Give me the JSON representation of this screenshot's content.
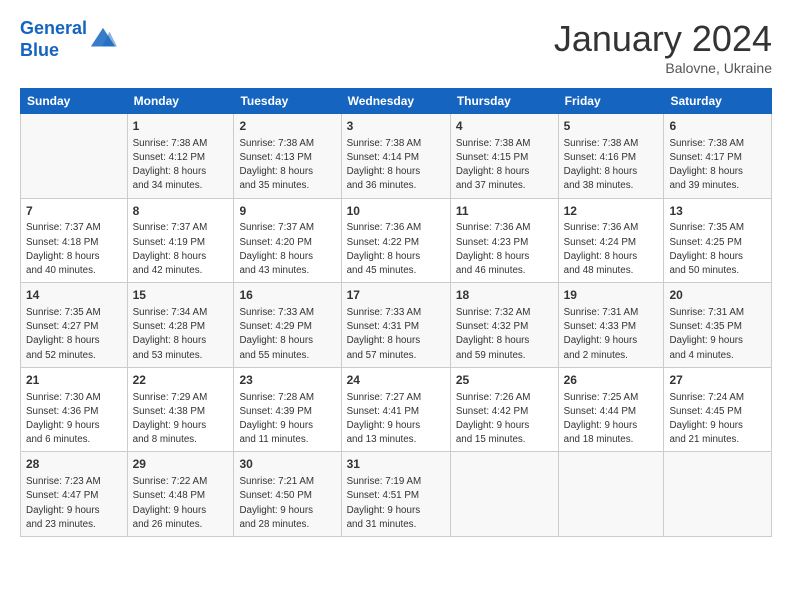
{
  "logo": {
    "line1": "General",
    "line2": "Blue"
  },
  "header": {
    "month": "January 2024",
    "location": "Balovne, Ukraine"
  },
  "days_of_week": [
    "Sunday",
    "Monday",
    "Tuesday",
    "Wednesday",
    "Thursday",
    "Friday",
    "Saturday"
  ],
  "weeks": [
    [
      {
        "day": "",
        "info": ""
      },
      {
        "day": "1",
        "info": "Sunrise: 7:38 AM\nSunset: 4:12 PM\nDaylight: 8 hours\nand 34 minutes."
      },
      {
        "day": "2",
        "info": "Sunrise: 7:38 AM\nSunset: 4:13 PM\nDaylight: 8 hours\nand 35 minutes."
      },
      {
        "day": "3",
        "info": "Sunrise: 7:38 AM\nSunset: 4:14 PM\nDaylight: 8 hours\nand 36 minutes."
      },
      {
        "day": "4",
        "info": "Sunrise: 7:38 AM\nSunset: 4:15 PM\nDaylight: 8 hours\nand 37 minutes."
      },
      {
        "day": "5",
        "info": "Sunrise: 7:38 AM\nSunset: 4:16 PM\nDaylight: 8 hours\nand 38 minutes."
      },
      {
        "day": "6",
        "info": "Sunrise: 7:38 AM\nSunset: 4:17 PM\nDaylight: 8 hours\nand 39 minutes."
      }
    ],
    [
      {
        "day": "7",
        "info": "Sunrise: 7:37 AM\nSunset: 4:18 PM\nDaylight: 8 hours\nand 40 minutes."
      },
      {
        "day": "8",
        "info": "Sunrise: 7:37 AM\nSunset: 4:19 PM\nDaylight: 8 hours\nand 42 minutes."
      },
      {
        "day": "9",
        "info": "Sunrise: 7:37 AM\nSunset: 4:20 PM\nDaylight: 8 hours\nand 43 minutes."
      },
      {
        "day": "10",
        "info": "Sunrise: 7:36 AM\nSunset: 4:22 PM\nDaylight: 8 hours\nand 45 minutes."
      },
      {
        "day": "11",
        "info": "Sunrise: 7:36 AM\nSunset: 4:23 PM\nDaylight: 8 hours\nand 46 minutes."
      },
      {
        "day": "12",
        "info": "Sunrise: 7:36 AM\nSunset: 4:24 PM\nDaylight: 8 hours\nand 48 minutes."
      },
      {
        "day": "13",
        "info": "Sunrise: 7:35 AM\nSunset: 4:25 PM\nDaylight: 8 hours\nand 50 minutes."
      }
    ],
    [
      {
        "day": "14",
        "info": "Sunrise: 7:35 AM\nSunset: 4:27 PM\nDaylight: 8 hours\nand 52 minutes."
      },
      {
        "day": "15",
        "info": "Sunrise: 7:34 AM\nSunset: 4:28 PM\nDaylight: 8 hours\nand 53 minutes."
      },
      {
        "day": "16",
        "info": "Sunrise: 7:33 AM\nSunset: 4:29 PM\nDaylight: 8 hours\nand 55 minutes."
      },
      {
        "day": "17",
        "info": "Sunrise: 7:33 AM\nSunset: 4:31 PM\nDaylight: 8 hours\nand 57 minutes."
      },
      {
        "day": "18",
        "info": "Sunrise: 7:32 AM\nSunset: 4:32 PM\nDaylight: 8 hours\nand 59 minutes."
      },
      {
        "day": "19",
        "info": "Sunrise: 7:31 AM\nSunset: 4:33 PM\nDaylight: 9 hours\nand 2 minutes."
      },
      {
        "day": "20",
        "info": "Sunrise: 7:31 AM\nSunset: 4:35 PM\nDaylight: 9 hours\nand 4 minutes."
      }
    ],
    [
      {
        "day": "21",
        "info": "Sunrise: 7:30 AM\nSunset: 4:36 PM\nDaylight: 9 hours\nand 6 minutes."
      },
      {
        "day": "22",
        "info": "Sunrise: 7:29 AM\nSunset: 4:38 PM\nDaylight: 9 hours\nand 8 minutes."
      },
      {
        "day": "23",
        "info": "Sunrise: 7:28 AM\nSunset: 4:39 PM\nDaylight: 9 hours\nand 11 minutes."
      },
      {
        "day": "24",
        "info": "Sunrise: 7:27 AM\nSunset: 4:41 PM\nDaylight: 9 hours\nand 13 minutes."
      },
      {
        "day": "25",
        "info": "Sunrise: 7:26 AM\nSunset: 4:42 PM\nDaylight: 9 hours\nand 15 minutes."
      },
      {
        "day": "26",
        "info": "Sunrise: 7:25 AM\nSunset: 4:44 PM\nDaylight: 9 hours\nand 18 minutes."
      },
      {
        "day": "27",
        "info": "Sunrise: 7:24 AM\nSunset: 4:45 PM\nDaylight: 9 hours\nand 21 minutes."
      }
    ],
    [
      {
        "day": "28",
        "info": "Sunrise: 7:23 AM\nSunset: 4:47 PM\nDaylight: 9 hours\nand 23 minutes."
      },
      {
        "day": "29",
        "info": "Sunrise: 7:22 AM\nSunset: 4:48 PM\nDaylight: 9 hours\nand 26 minutes."
      },
      {
        "day": "30",
        "info": "Sunrise: 7:21 AM\nSunset: 4:50 PM\nDaylight: 9 hours\nand 28 minutes."
      },
      {
        "day": "31",
        "info": "Sunrise: 7:19 AM\nSunset: 4:51 PM\nDaylight: 9 hours\nand 31 minutes."
      },
      {
        "day": "",
        "info": ""
      },
      {
        "day": "",
        "info": ""
      },
      {
        "day": "",
        "info": ""
      }
    ]
  ]
}
